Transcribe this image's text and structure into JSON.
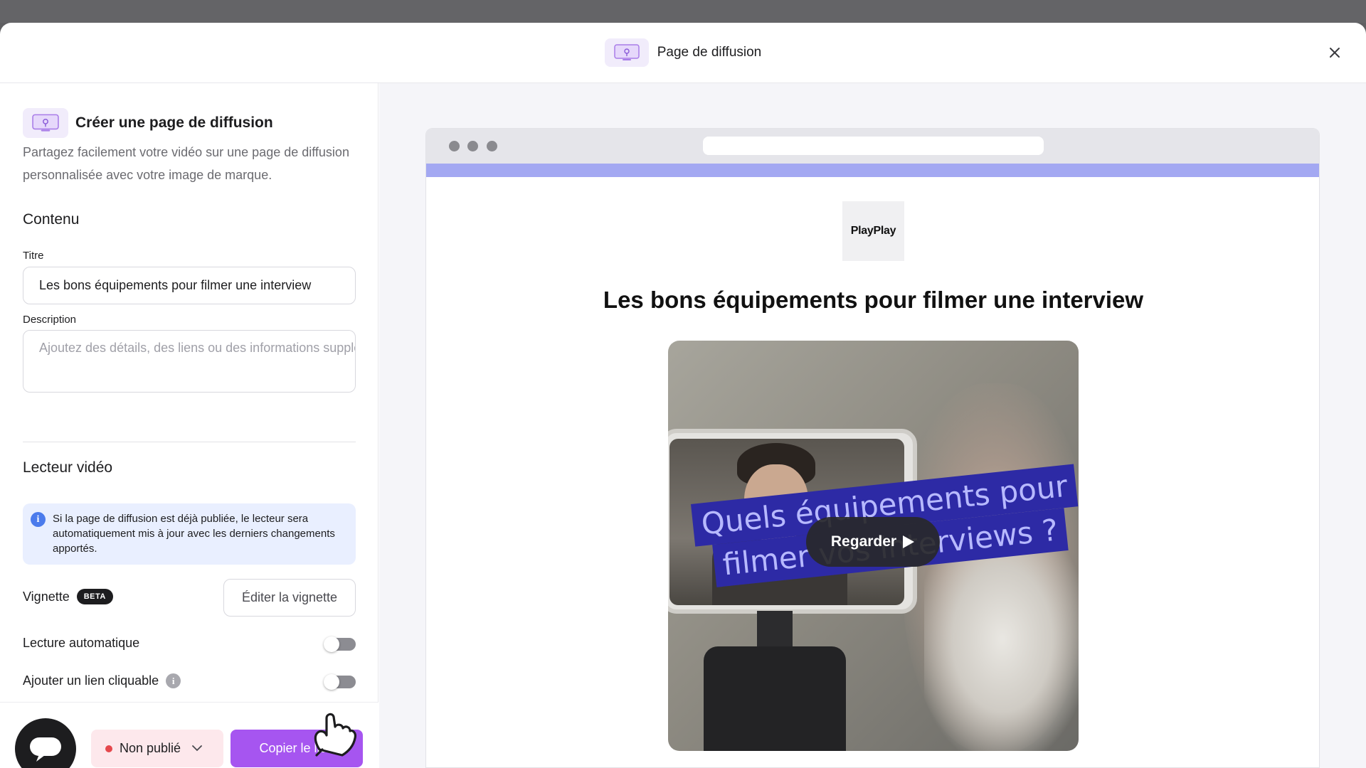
{
  "modal": {
    "title": "Page de diffusion"
  },
  "panel": {
    "create_title": "Créer une page de diffusion",
    "create_description": "Partagez facilement votre vidéo sur une page de diffusion personnalisée avec votre image de marque.",
    "content_section": "Contenu",
    "title_label": "Titre",
    "title_value": "Les bons équipements pour filmer une interview",
    "description_label": "Description",
    "description_placeholder": "Ajoutez des détails, des liens ou des informations supplémentaires",
    "player_section": "Lecteur vidéo",
    "info_text": "Si la page de diffusion est déjà publiée, le lecteur sera automatiquement mis à jour avec les derniers changements apportés.",
    "thumbnail_label": "Vignette",
    "beta_badge": "BETA",
    "edit_thumbnail_button": "Éditer la vignette",
    "autoplay_label": "Lecture automatique",
    "autoplay_on": false,
    "clickable_link_label": "Ajouter un lien cliquable",
    "clickable_link_on": false
  },
  "footer": {
    "status_label": "Non publié",
    "copy_link_button": "Copier le lien"
  },
  "preview": {
    "logo_text": "PlayPlay",
    "page_title": "Les bons équipements pour filmer une interview",
    "video_caption_line1": "Quels équipements pour",
    "video_caption_line2": "filmer vos interviews ?",
    "watch_button": "Regarder"
  },
  "colors": {
    "accent": "#a655f0",
    "brand_strip": "#a3a8f2",
    "status_dot": "#e5484d",
    "info_bg": "#e9efff"
  },
  "icons": {
    "header": "broadcast-page-icon",
    "close": "close-icon",
    "info": "info-icon",
    "help": "help-icon",
    "chat": "chat-bubble-icon",
    "chevron": "chevron-down-icon",
    "play": "play-icon",
    "cursor": "pointer-hand-icon"
  }
}
